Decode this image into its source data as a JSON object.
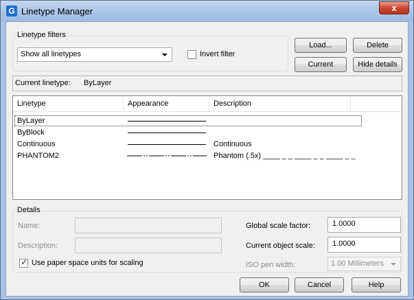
{
  "window": {
    "title": "Linetype Manager",
    "app_icon_letter": "G",
    "close_glyph": "x"
  },
  "filters": {
    "group_label": "Linetype filters",
    "filter_value": "Show all linetypes",
    "invert_filter_label": "Invert filter",
    "invert_filter_checked": false
  },
  "buttons": {
    "load": "Load...",
    "delete": "Delete",
    "current": "Current",
    "hide_details": "Hide details",
    "ok": "OK",
    "cancel": "Cancel",
    "help": "Help"
  },
  "current_linetype": {
    "label": "Current linetype:",
    "value": "ByLayer"
  },
  "list": {
    "columns": [
      "Linetype",
      "Appearance",
      "Description"
    ],
    "rows": [
      {
        "name": "ByLayer",
        "appearance": "solid",
        "description": "",
        "selected": true
      },
      {
        "name": "ByBlock",
        "appearance": "solid",
        "description": "",
        "selected": false
      },
      {
        "name": "Continuous",
        "appearance": "solid",
        "description": "Continuous",
        "selected": false
      },
      {
        "name": "PHANTOM2",
        "appearance": "phantom",
        "description": "Phantom (.5x) ____ _ _ ____ _ _ ____ _ _",
        "selected": false
      }
    ]
  },
  "details": {
    "group_label": "Details",
    "name_label": "Name:",
    "name_value": "",
    "description_label": "Description:",
    "description_value": "",
    "paper_space_label": "Use paper space units for scaling",
    "paper_space_checked": true,
    "global_scale_label": "Global scale factor:",
    "global_scale_value": "1.0000",
    "current_object_scale_label": "Current object scale:",
    "current_object_scale_value": "1.0000",
    "iso_pen_label": "ISO pen width:",
    "iso_pen_value": "1.00 Millimeters"
  }
}
